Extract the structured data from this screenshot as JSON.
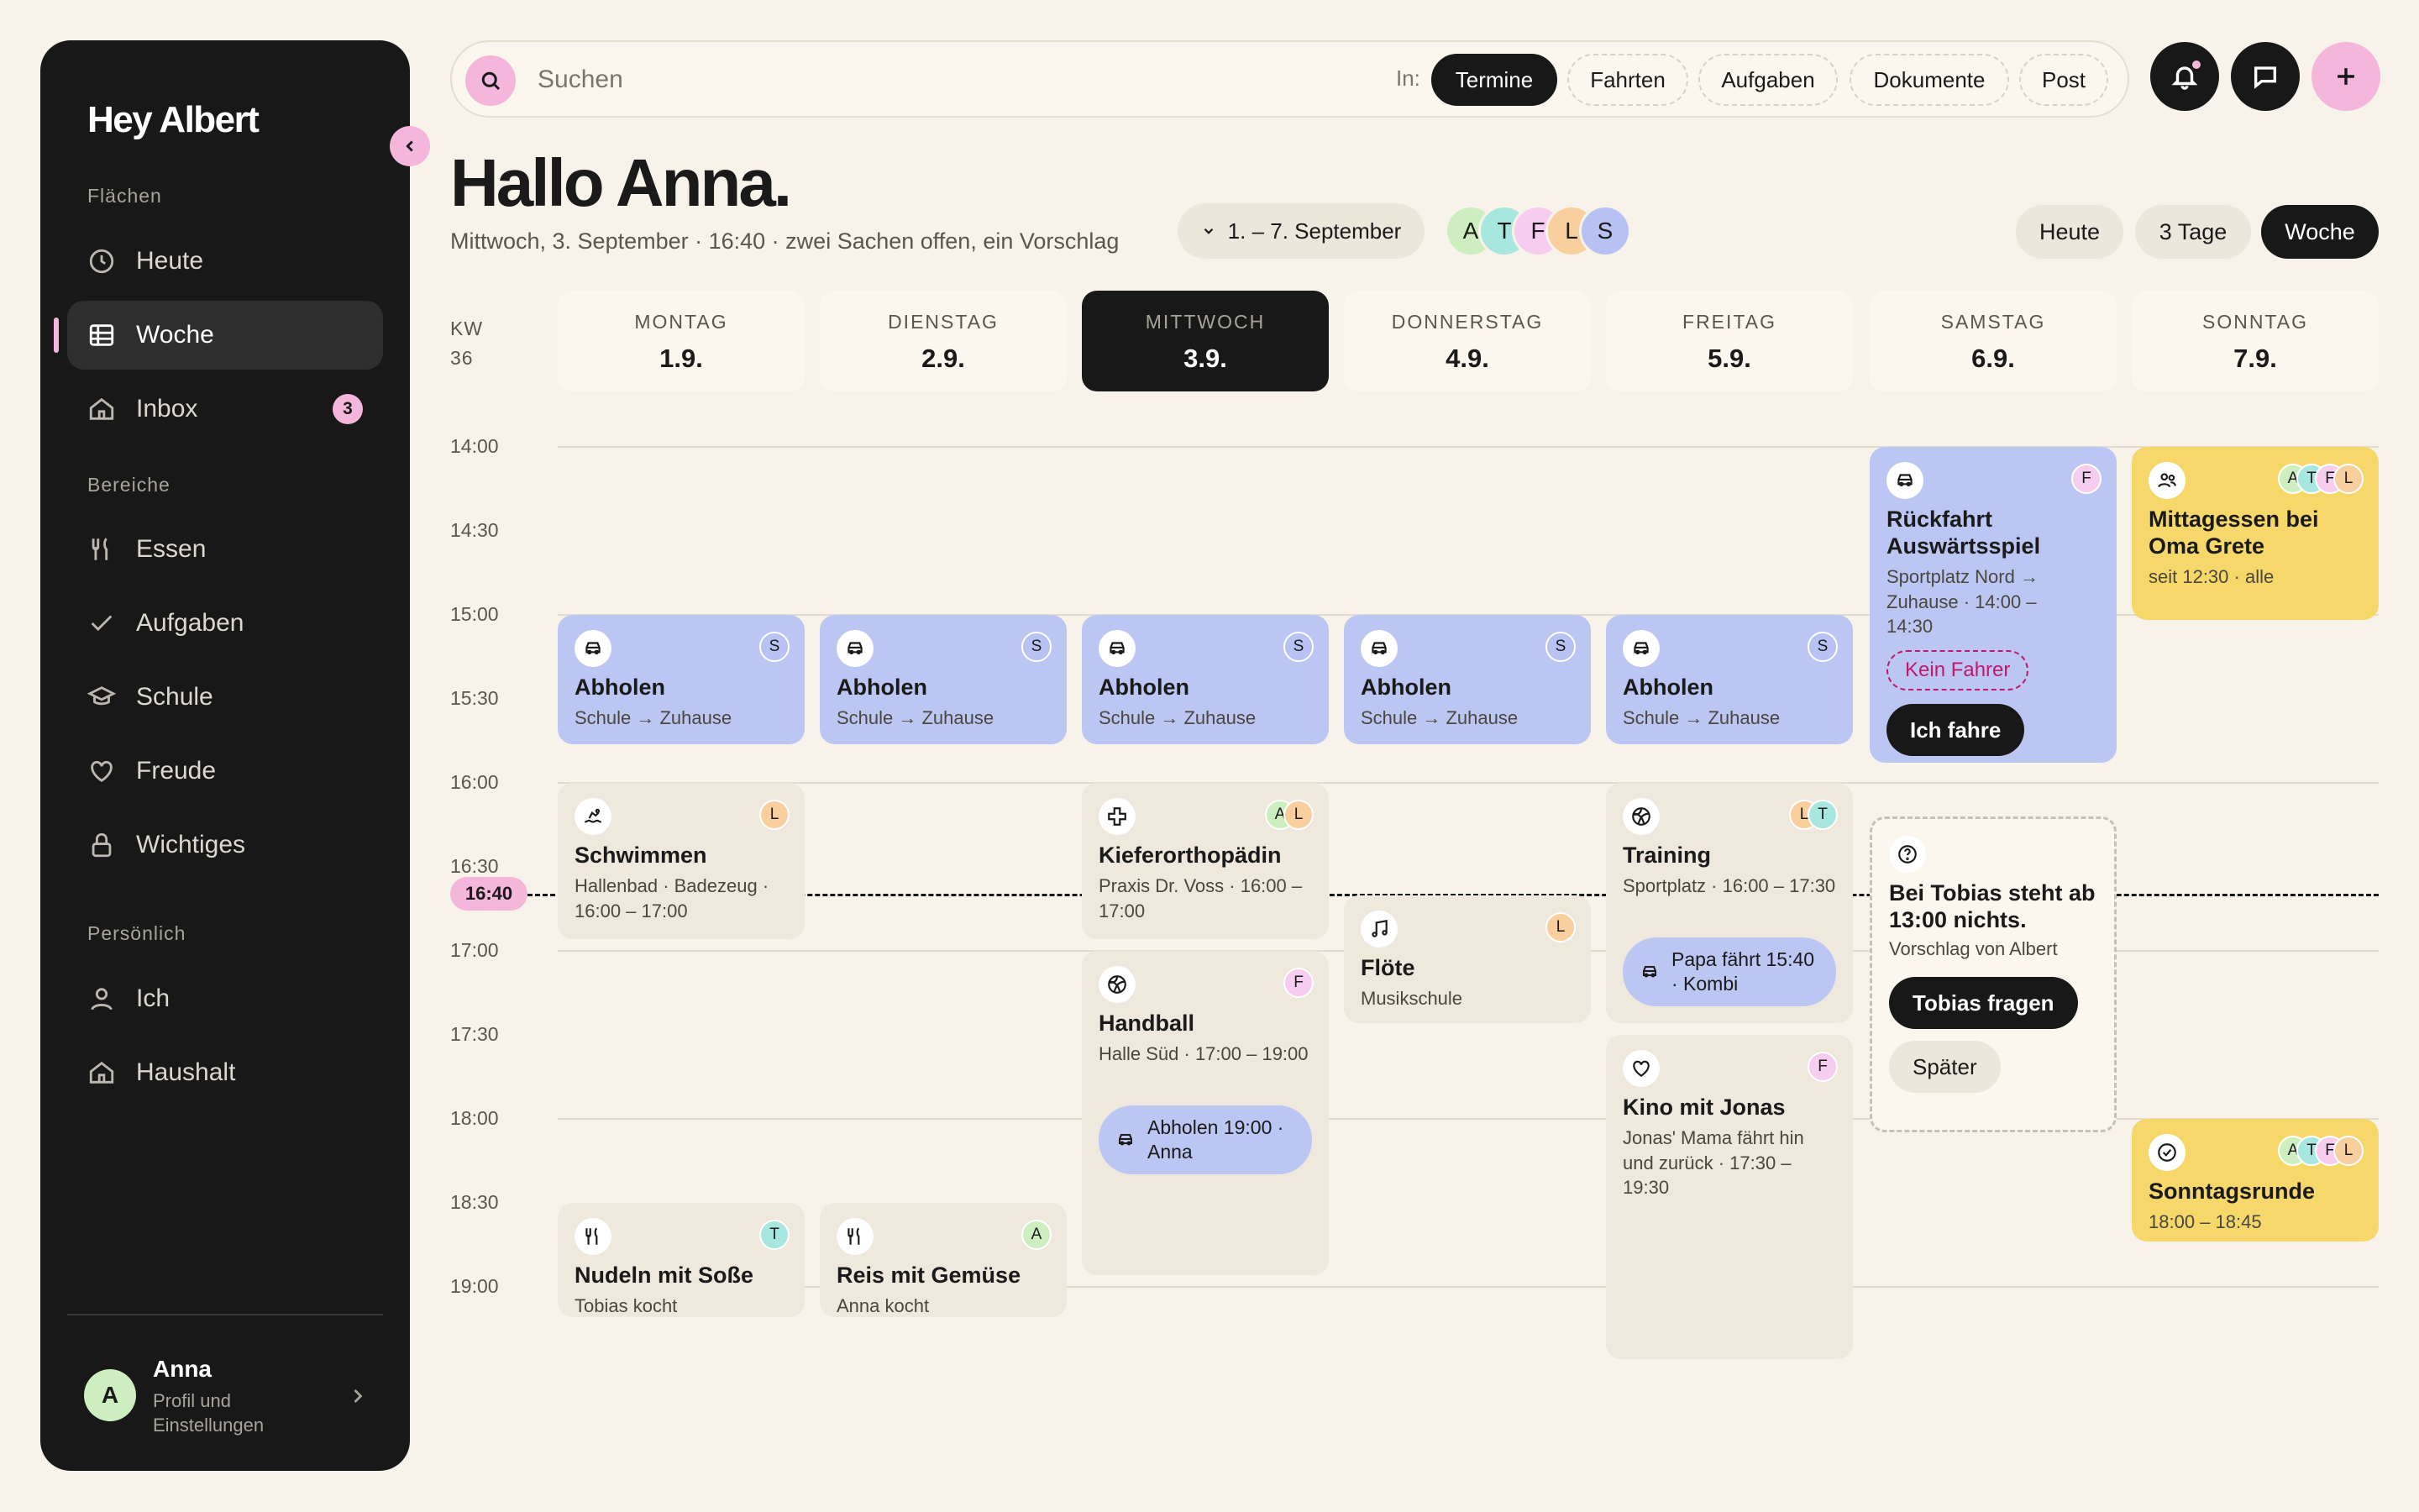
{
  "app": {
    "brand": "Hey Albert"
  },
  "sidebar": {
    "sections": [
      "Flächen",
      "Bereiche",
      "Persönlich"
    ],
    "flaechen": [
      {
        "label": "Heute",
        "icon": "clock-icon"
      },
      {
        "label": "Woche",
        "icon": "grid-icon",
        "active": true
      },
      {
        "label": "Inbox",
        "icon": "home-icon",
        "badge": "3"
      }
    ],
    "bereiche": [
      {
        "label": "Essen",
        "icon": "cutlery-icon"
      },
      {
        "label": "Aufgaben",
        "icon": "check-icon"
      },
      {
        "label": "Schule",
        "icon": "graduation-cap-icon"
      },
      {
        "label": "Freude",
        "icon": "heart-icon"
      },
      {
        "label": "Wichtiges",
        "icon": "lock-icon"
      }
    ],
    "persoenlich": [
      {
        "label": "Ich",
        "icon": "user-icon"
      },
      {
        "label": "Haushalt",
        "icon": "home-icon"
      }
    ],
    "profile": {
      "initial": "A",
      "name": "Anna",
      "sub": "Profil und Einstellungen"
    }
  },
  "search": {
    "placeholder": "Suchen",
    "filter_label": "In:",
    "filters": [
      "Termine",
      "Fahrten",
      "Aufgaben",
      "Dokumente",
      "Post"
    ],
    "active_filter": "Termine"
  },
  "header": {
    "greeting": "Hallo Anna.",
    "subline": "Mittwoch, 3. September · 16:40 · zwei Sachen offen, ein Vorschlag",
    "range": "1. – 7. September",
    "members": [
      {
        "initial": "A",
        "color": "#CDEFC0"
      },
      {
        "initial": "T",
        "color": "#A8E6E0"
      },
      {
        "initial": "F",
        "color": "#F6CDEF"
      },
      {
        "initial": "L",
        "color": "#F9CF9E"
      },
      {
        "initial": "S",
        "color": "#B7C1F2"
      }
    ],
    "views": [
      "Heute",
      "3 Tage",
      "Woche"
    ],
    "active_view": "Woche"
  },
  "calendar": {
    "kw_label": "KW",
    "kw_number": "36",
    "days": [
      {
        "name": "MONTAG",
        "date": "1.9."
      },
      {
        "name": "DIENSTAG",
        "date": "2.9."
      },
      {
        "name": "MITTWOCH",
        "date": "3.9.",
        "today": true
      },
      {
        "name": "DONNERSTAG",
        "date": "4.9."
      },
      {
        "name": "FREITAG",
        "date": "5.9."
      },
      {
        "name": "SAMSTAG",
        "date": "6.9."
      },
      {
        "name": "SONNTAG",
        "date": "7.9."
      }
    ],
    "times": [
      "14:00",
      "14:30",
      "15:00",
      "15:30",
      "16:00",
      "16:30",
      "17:00",
      "17:30",
      "18:00",
      "18:30",
      "19:00"
    ],
    "now": "16:40",
    "events": {
      "abholen_title": "Abholen",
      "abholen_sub": "Schule → Zuhause",
      "abholen_person": "S",
      "schwimmen": {
        "title": "Schwimmen",
        "sub": "Hallenbad · Badezeug · 16:00 – 17:00",
        "person": "L"
      },
      "nudeln": {
        "title": "Nudeln mit Soße",
        "sub": "Tobias kocht",
        "person": "T"
      },
      "reis": {
        "title": "Reis mit Gemüse",
        "sub": "Anna kocht",
        "person": "A"
      },
      "kiefer": {
        "title": "Kieferorthopädin",
        "sub": "Praxis Dr. Voss · 16:00 – 17:00",
        "persons": [
          "A",
          "L"
        ]
      },
      "handball": {
        "title": "Handball",
        "sub": "Halle Süd · 17:00 – 19:00",
        "person": "F",
        "pill": "Abholen 19:00 · Anna"
      },
      "floete": {
        "title": "Flöte",
        "sub": "Musikschule",
        "person": "L"
      },
      "training": {
        "title": "Training",
        "sub": "Sportplatz · 16:00 – 17:30",
        "persons": [
          "L",
          "T"
        ],
        "pill": "Papa fährt 15:40 · Kombi"
      },
      "kino": {
        "title": "Kino mit Jonas",
        "sub": "Jonas' Mama fährt hin und zurück · 17:30 – 19:30",
        "person": "F"
      },
      "rueckfahrt": {
        "title": "Rückfahrt Auswärtsspiel",
        "sub": "Sportplatz Nord → Zuhause · 14:00 – 14:30",
        "person": "F",
        "warning": "Kein Fahrer",
        "action": "Ich fahre"
      },
      "suggestion": {
        "title": "Bei Tobias steht ab 13:00 nichts.",
        "sub": "Vorschlag von Albert",
        "primary": "Tobias fragen",
        "secondary": "Später"
      },
      "mittagessen": {
        "title": "Mittagessen bei Oma Grete",
        "sub": "seit 12:30 · alle",
        "persons": [
          "A",
          "T",
          "F",
          "L"
        ]
      },
      "sonntagsrunde": {
        "title": "Sonntagsrunde",
        "sub": "18:00 – 18:45",
        "persons": [
          "A",
          "T",
          "F",
          "L"
        ]
      }
    }
  }
}
